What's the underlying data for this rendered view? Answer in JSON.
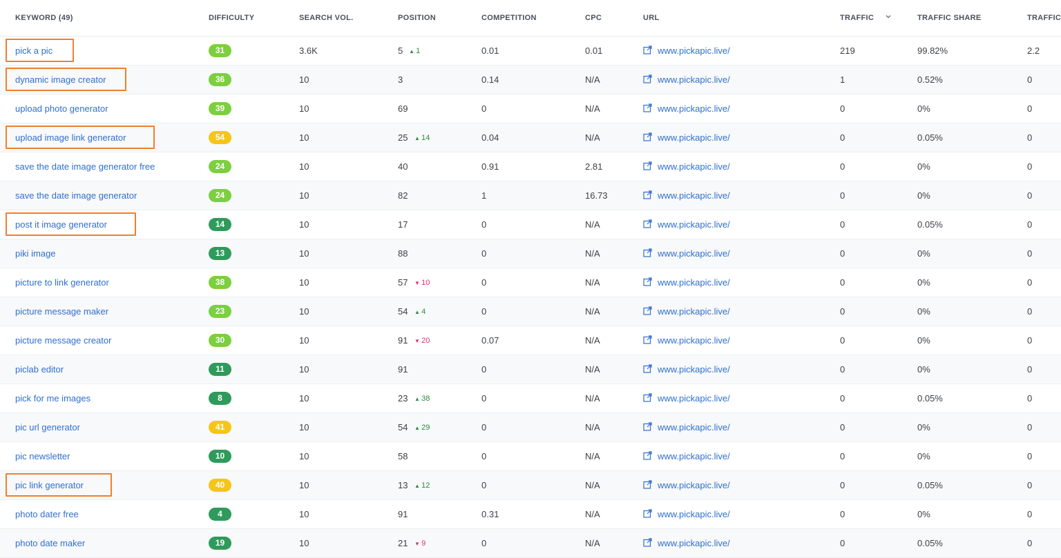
{
  "header": {
    "keyword": "KEYWORD (49)",
    "difficulty": "DIFFICULTY",
    "search_vol": "SEARCH VOL.",
    "position": "POSITION",
    "competition": "COMPETITION",
    "cpc": "CPC",
    "url": "URL",
    "traffic": "TRAFFIC",
    "traffic_share": "TRAFFIC SHARE",
    "traffic_cost": "TRAFFIC"
  },
  "colors": {
    "difficulty_light_green": "#7ccf3e",
    "difficulty_yellow": "#f5c518",
    "difficulty_dark_green": "#2f9a5b",
    "highlight": "#f07f2b",
    "link": "#2f6fcf"
  },
  "rows": [
    {
      "keyword": "pick a pic",
      "difficulty": "31",
      "dcolor": "#7ccf3e",
      "volume": "3.6K",
      "position": "5",
      "delta": "1",
      "dir": "up",
      "competition": "0.01",
      "cpc": "0.01",
      "url": "www.pickapic.live/",
      "traffic": "219",
      "share": "99.82%",
      "cost": "2.2",
      "hl": true
    },
    {
      "keyword": "dynamic image creator",
      "difficulty": "36",
      "dcolor": "#7ccf3e",
      "volume": "10",
      "position": "3",
      "delta": "",
      "dir": "",
      "competition": "0.14",
      "cpc": "N/A",
      "url": "www.pickapic.live/",
      "traffic": "1",
      "share": "0.52%",
      "cost": "0",
      "hl": true
    },
    {
      "keyword": "upload photo generator",
      "difficulty": "39",
      "dcolor": "#7ccf3e",
      "volume": "10",
      "position": "69",
      "delta": "",
      "dir": "",
      "competition": "0",
      "cpc": "N/A",
      "url": "www.pickapic.live/",
      "traffic": "0",
      "share": "0%",
      "cost": "0",
      "hl": false
    },
    {
      "keyword": "upload image link generator",
      "difficulty": "54",
      "dcolor": "#f5c518",
      "volume": "10",
      "position": "25",
      "delta": "14",
      "dir": "up",
      "competition": "0.04",
      "cpc": "N/A",
      "url": "www.pickapic.live/",
      "traffic": "0",
      "share": "0.05%",
      "cost": "0",
      "hl": true
    },
    {
      "keyword": "save the date image generator free",
      "difficulty": "24",
      "dcolor": "#7ccf3e",
      "volume": "10",
      "position": "40",
      "delta": "",
      "dir": "",
      "competition": "0.91",
      "cpc": "2.81",
      "url": "www.pickapic.live/",
      "traffic": "0",
      "share": "0%",
      "cost": "0",
      "hl": false
    },
    {
      "keyword": "save the date image generator",
      "difficulty": "24",
      "dcolor": "#7ccf3e",
      "volume": "10",
      "position": "82",
      "delta": "",
      "dir": "",
      "competition": "1",
      "cpc": "16.73",
      "url": "www.pickapic.live/",
      "traffic": "0",
      "share": "0%",
      "cost": "0",
      "hl": false
    },
    {
      "keyword": "post it image generator",
      "difficulty": "14",
      "dcolor": "#2f9a5b",
      "volume": "10",
      "position": "17",
      "delta": "",
      "dir": "",
      "competition": "0",
      "cpc": "N/A",
      "url": "www.pickapic.live/",
      "traffic": "0",
      "share": "0.05%",
      "cost": "0",
      "hl": true
    },
    {
      "keyword": "piki image",
      "difficulty": "13",
      "dcolor": "#2f9a5b",
      "volume": "10",
      "position": "88",
      "delta": "",
      "dir": "",
      "competition": "0",
      "cpc": "N/A",
      "url": "www.pickapic.live/",
      "traffic": "0",
      "share": "0%",
      "cost": "0",
      "hl": false
    },
    {
      "keyword": "picture to link generator",
      "difficulty": "38",
      "dcolor": "#7ccf3e",
      "volume": "10",
      "position": "57",
      "delta": "10",
      "dir": "down",
      "competition": "0",
      "cpc": "N/A",
      "url": "www.pickapic.live/",
      "traffic": "0",
      "share": "0%",
      "cost": "0",
      "hl": false
    },
    {
      "keyword": "picture message maker",
      "difficulty": "23",
      "dcolor": "#7ccf3e",
      "volume": "10",
      "position": "54",
      "delta": "4",
      "dir": "up",
      "competition": "0",
      "cpc": "N/A",
      "url": "www.pickapic.live/",
      "traffic": "0",
      "share": "0%",
      "cost": "0",
      "hl": false
    },
    {
      "keyword": "picture message creator",
      "difficulty": "30",
      "dcolor": "#7ccf3e",
      "volume": "10",
      "position": "91",
      "delta": "20",
      "dir": "down",
      "competition": "0.07",
      "cpc": "N/A",
      "url": "www.pickapic.live/",
      "traffic": "0",
      "share": "0%",
      "cost": "0",
      "hl": false
    },
    {
      "keyword": "piclab editor",
      "difficulty": "11",
      "dcolor": "#2f9a5b",
      "volume": "10",
      "position": "91",
      "delta": "",
      "dir": "",
      "competition": "0",
      "cpc": "N/A",
      "url": "www.pickapic.live/",
      "traffic": "0",
      "share": "0%",
      "cost": "0",
      "hl": false
    },
    {
      "keyword": "pick for me images",
      "difficulty": "8",
      "dcolor": "#2f9a5b",
      "volume": "10",
      "position": "23",
      "delta": "38",
      "dir": "up",
      "competition": "0",
      "cpc": "N/A",
      "url": "www.pickapic.live/",
      "traffic": "0",
      "share": "0.05%",
      "cost": "0",
      "hl": false
    },
    {
      "keyword": "pic url generator",
      "difficulty": "41",
      "dcolor": "#f5c518",
      "volume": "10",
      "position": "54",
      "delta": "29",
      "dir": "up",
      "competition": "0",
      "cpc": "N/A",
      "url": "www.pickapic.live/",
      "traffic": "0",
      "share": "0%",
      "cost": "0",
      "hl": false
    },
    {
      "keyword": "pic newsletter",
      "difficulty": "10",
      "dcolor": "#2f9a5b",
      "volume": "10",
      "position": "58",
      "delta": "",
      "dir": "",
      "competition": "0",
      "cpc": "N/A",
      "url": "www.pickapic.live/",
      "traffic": "0",
      "share": "0%",
      "cost": "0",
      "hl": false
    },
    {
      "keyword": "pic link generator",
      "difficulty": "40",
      "dcolor": "#f5c518",
      "volume": "10",
      "position": "13",
      "delta": "12",
      "dir": "up",
      "competition": "0",
      "cpc": "N/A",
      "url": "www.pickapic.live/",
      "traffic": "0",
      "share": "0.05%",
      "cost": "0",
      "hl": true
    },
    {
      "keyword": "photo dater free",
      "difficulty": "4",
      "dcolor": "#2f9a5b",
      "volume": "10",
      "position": "91",
      "delta": "",
      "dir": "",
      "competition": "0.31",
      "cpc": "N/A",
      "url": "www.pickapic.live/",
      "traffic": "0",
      "share": "0%",
      "cost": "0",
      "hl": false
    },
    {
      "keyword": "photo date maker",
      "difficulty": "19",
      "dcolor": "#2f9a5b",
      "volume": "10",
      "position": "21",
      "delta": "9",
      "dir": "down",
      "competition": "0",
      "cpc": "N/A",
      "url": "www.pickapic.live/",
      "traffic": "0",
      "share": "0.05%",
      "cost": "0",
      "hl": false
    }
  ]
}
